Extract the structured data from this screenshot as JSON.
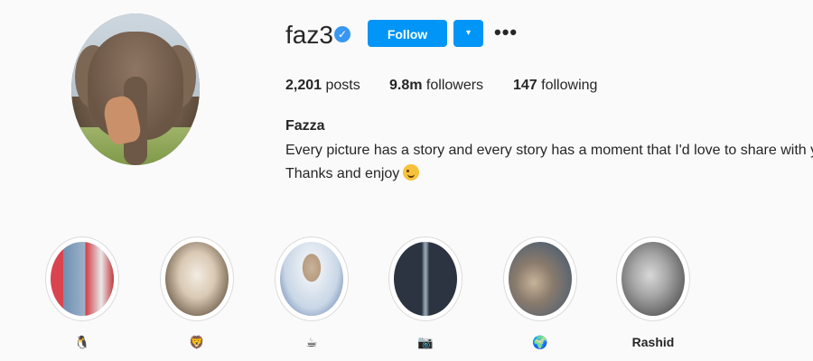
{
  "profile": {
    "username": "faz3",
    "verified": true,
    "follow_label": "Follow",
    "dropdown_icon": "▾",
    "more_icon": "•••",
    "stats": {
      "posts_count": "2,201",
      "posts_label": "posts",
      "followers_count": "9.8m",
      "followers_label": "followers",
      "following_count": "147",
      "following_label": "following"
    },
    "full_name": "Fazza",
    "bio_line1": "Every picture has a story and every story has a moment that I'd love to share with you",
    "bio_line2": "Thanks and enjoy"
  },
  "highlights": [
    {
      "label": "🐧",
      "icon": "penguin-emoji"
    },
    {
      "label": "🦁",
      "icon": "lion-emoji"
    },
    {
      "label": "☕",
      "icon": "coffee-emoji"
    },
    {
      "label": "📷",
      "icon": "camera-emoji"
    },
    {
      "label": "🌍",
      "icon": "globe-emoji"
    },
    {
      "label": "Rashid",
      "icon": ""
    }
  ],
  "colors": {
    "accent": "#0095f6",
    "verified": "#3897f0",
    "background": "#fafafa",
    "text": "#262626"
  }
}
